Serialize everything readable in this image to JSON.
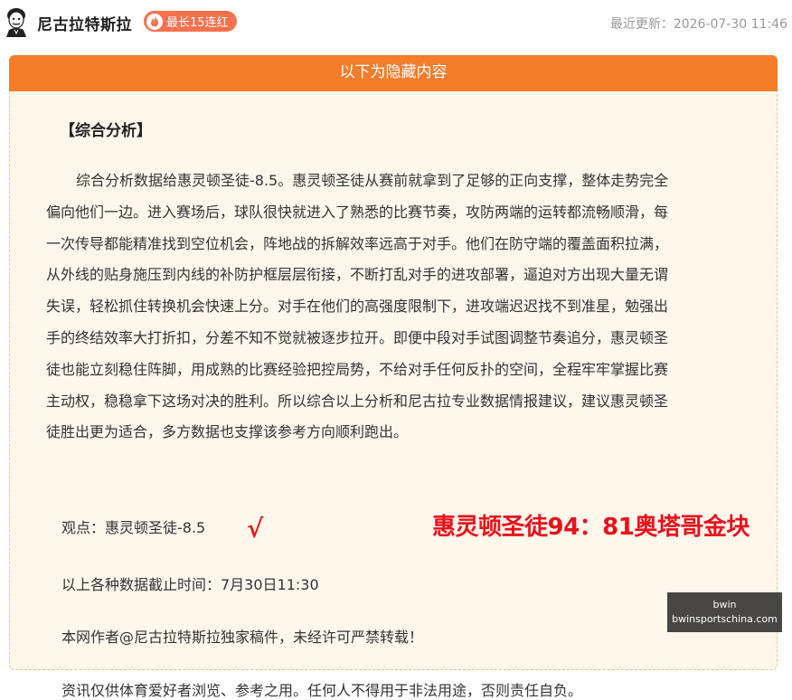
{
  "header": {
    "author": "尼古拉特斯拉",
    "badge": "最长15连红",
    "updated": "最近更新：2026-07-30 11:46",
    "icons": {
      "avatar": "tesla-portrait-avatar",
      "badge": "flame-icon"
    }
  },
  "panel": {
    "title": "以下为隐藏内容",
    "section_title": "【综合分析】",
    "analysis_lines": [
      "　综合分析数据给惠灵顿圣徒-8.5。惠灵顿圣徒从赛前就拿到了足够的正向支撑，整体走势完全",
      "偏向他们一边。进入赛场后，球队很快就进入了熟悉的比赛节奏，攻防两端的运转都流畅顺滑，每",
      "一次传导都能精准找到空位机会，阵地战的拆解效率远高于对手。他们在防守端的覆盖面积拉满，",
      "从外线的贴身施压到内线的补防护框层层衔接，不断打乱对手的进攻部署，逼迫对方出现大量无谓",
      "失误，轻松抓住转换机会快速上分。对手在他们的高强度限制下，进攻端迟迟找不到准星，勉强出",
      "手的终结效率大打折扣，分差不知不觉就被逐步拉开。即便中段对手试图调整节奏追分，惠灵顿圣",
      "徒也能立刻稳住阵脚，用成熟的比赛经验把控局势，不给对手任何反扑的空间，全程牢牢掌握比赛",
      "主动权，稳稳拿下这场对决的胜利。所以综合以上分析和尼古拉专业数据情报建议，建议惠灵顿圣",
      "徒胜出更为适合，多方数据也支撑该参考方向顺利跑出。"
    ],
    "viewpoint": "观点：惠灵顿圣徒-8.5",
    "check_mark": "√",
    "result": "惠灵顿圣徒94：81奥塔哥金块",
    "deadline": "以上各种数据截止时间：7月30日11:30",
    "copyright": "本网作者@尼古拉特斯拉独家稿件，未经许可严禁转载！",
    "disclaimer": "资讯仅供体育爱好者浏览、参考之用。任何人不得用于非法用途，否则责任自负。"
  },
  "watermark": {
    "line1": "bwin",
    "line2": "bwinsportschina.com"
  },
  "colors": {
    "panel_header": "#f37d2a",
    "panel_bg": "#fdf7ec",
    "badge": "#f9704d",
    "result_red": "#e8111c"
  }
}
